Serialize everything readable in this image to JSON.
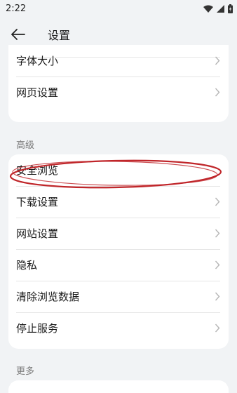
{
  "status_bar": {
    "time": "2:22"
  },
  "app_bar": {
    "title": "设置"
  },
  "top_card": {
    "items": [
      {
        "label": "字体大小"
      },
      {
        "label": "网页设置"
      }
    ]
  },
  "advanced": {
    "header": "高级",
    "items": [
      {
        "label": "安全浏览"
      },
      {
        "label": "下载设置"
      },
      {
        "label": "网站设置"
      },
      {
        "label": "隐私"
      },
      {
        "label": "清除浏览数据"
      },
      {
        "label": "停止服务"
      }
    ]
  },
  "more": {
    "header": "更多"
  },
  "colors": {
    "annotation": "#c0262a",
    "background": "#f1f3f5",
    "card": "#ffffff"
  }
}
